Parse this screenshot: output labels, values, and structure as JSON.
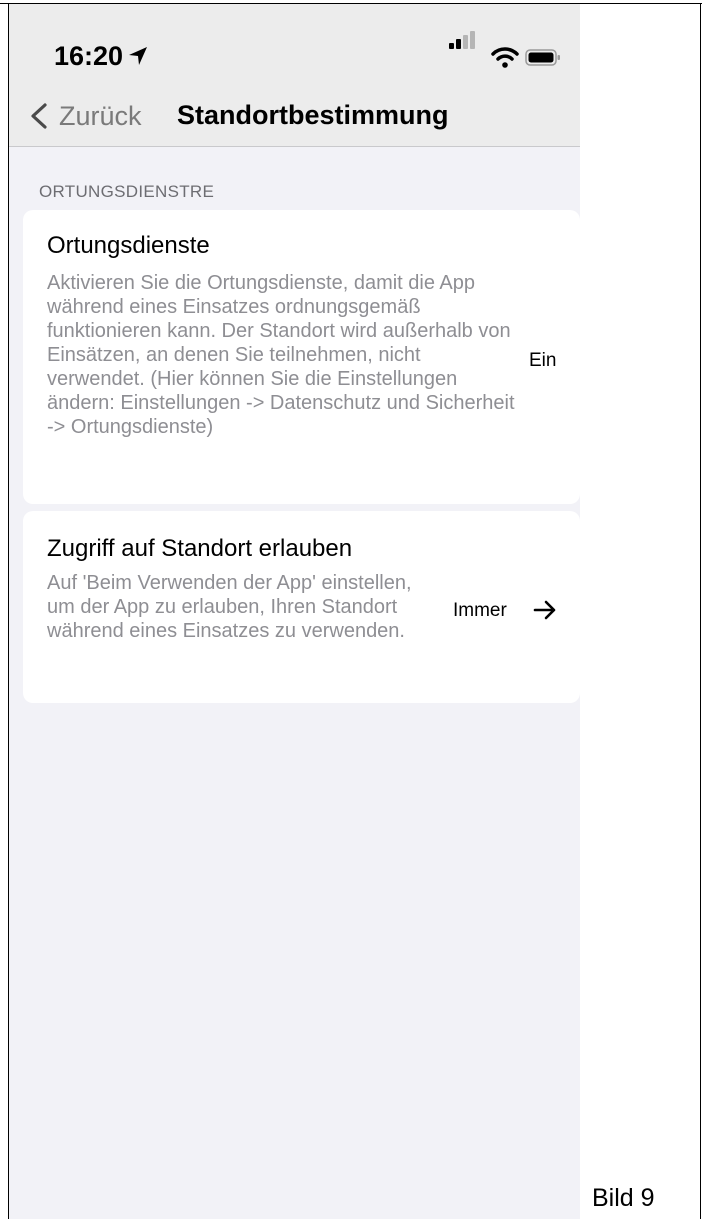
{
  "status_bar": {
    "time": "16:20",
    "icons": [
      "location-arrow-icon",
      "signal-icon",
      "wifi-icon",
      "battery-icon"
    ]
  },
  "nav": {
    "back_label": "Zurück",
    "title": "Standortbestimmung"
  },
  "section": {
    "header": "ORTUNGSDIENSTRE"
  },
  "rows": [
    {
      "title": "Ortungsdienste",
      "description": "Aktivieren Sie die Ortungsdienste, damit die App während eines Einsatzes ordnungsgemäß funktionieren kann. Der Standort wird außerhalb von Einsätzen, an denen Sie teilnehmen, nicht verwendet. (Hier können Sie die Einstellungen ändern: Einstellungen -> Datenschutz und Sicherheit -> Ortungsdienste)",
      "value": "Ein"
    },
    {
      "title": "Zugriff auf Standort erlauben",
      "description": "Auf 'Beim Verwenden der App' einstellen, um der App zu erlauben, Ihren Standort während eines Einsatzes zu verwenden.",
      "value": "Immer",
      "icon": "arrow-right-icon"
    }
  ],
  "caption": "Bild 9",
  "colors": {
    "background": "#f2f2f7",
    "nav_background": "#ececec",
    "secondary_text": "#8e8e93"
  }
}
